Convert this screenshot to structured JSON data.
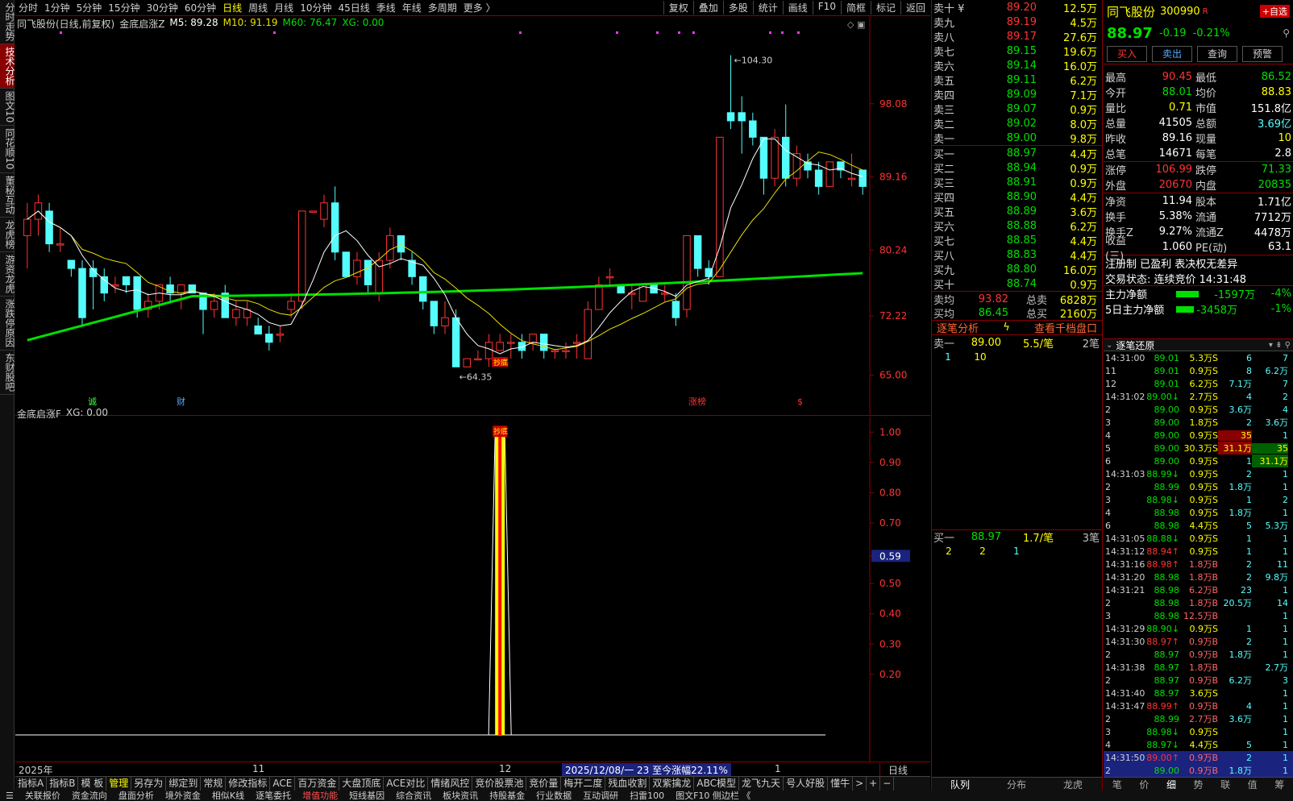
{
  "left_tabs": [
    "分时走势",
    "技术分析",
    "图文10",
    "同花顺10",
    "董秘互动",
    "龙虎榜",
    "游资龙虎",
    "涨跌停原因",
    "东财股吧"
  ],
  "toolbar": {
    "items": [
      "分时",
      "1分钟",
      "5分钟",
      "15分钟",
      "30分钟",
      "60分钟",
      "日线",
      "周线",
      "月线",
      "10分钟",
      "45日线",
      "季线",
      "年线",
      "多周期",
      "更多 〉"
    ],
    "active": "日线",
    "right": [
      "复权",
      "叠加",
      "多股",
      "统计",
      "画线",
      "F10",
      "简框",
      "标记",
      "返回"
    ]
  },
  "chart": {
    "legend_name": "同飞股份(日线,前复权)",
    "ind_name": "金底启涨Z",
    "ma5": "M5: 89.28",
    "ma10": "M10: 91.19",
    "ma60": "M60: 76.47",
    "xg": "XG: 0.00",
    "y_labels": [
      "98.08",
      "89.16",
      "80.24",
      "72.22",
      "65.00"
    ],
    "high_label": "104.30",
    "low_label": "64.35",
    "markers": [
      "诚",
      "财",
      "涨榜",
      "$"
    ],
    "buy_tag": "抄底"
  },
  "chart_data": {
    "type": "candlestick",
    "ylim": [
      62,
      107
    ],
    "candles": [
      [
        82,
        86,
        78,
        84
      ],
      [
        84,
        87,
        82,
        86
      ],
      [
        85,
        86,
        80,
        81
      ],
      [
        81,
        83,
        80,
        81
      ],
      [
        79,
        79,
        77,
        78
      ],
      [
        78,
        79,
        71,
        72
      ],
      [
        78,
        79,
        73,
        77
      ],
      [
        77,
        78,
        74,
        75
      ],
      [
        76,
        77,
        75,
        76
      ],
      [
        77,
        77,
        75,
        76
      ],
      [
        77,
        77,
        72,
        73
      ],
      [
        73,
        75,
        72,
        74
      ],
      [
        74,
        76,
        73,
        76
      ],
      [
        76,
        77,
        74,
        75
      ],
      [
        75,
        76,
        73,
        76
      ],
      [
        76,
        76,
        75,
        75
      ],
      [
        75,
        75,
        70,
        73
      ],
      [
        73,
        75,
        72,
        74
      ],
      [
        75,
        76,
        72,
        72
      ],
      [
        72,
        74,
        71,
        73
      ],
      [
        72,
        74,
        71,
        73
      ],
      [
        71,
        72,
        70,
        70
      ],
      [
        70,
        71,
        68,
        69
      ],
      [
        70,
        71,
        69,
        70
      ],
      [
        73,
        75,
        72,
        74
      ],
      [
        74,
        85,
        73,
        85
      ],
      [
        85,
        85,
        85,
        85
      ],
      [
        84,
        87,
        83,
        86
      ],
      [
        86,
        88,
        79,
        80
      ],
      [
        80,
        80,
        77,
        77
      ],
      [
        77,
        80,
        76,
        79
      ],
      [
        79,
        79,
        75,
        76
      ],
      [
        75,
        80,
        74,
        79
      ],
      [
        79,
        83,
        78,
        82
      ],
      [
        82,
        82,
        79,
        80
      ],
      [
        79,
        80,
        76,
        77
      ],
      [
        77,
        77,
        73,
        74
      ],
      [
        74,
        74,
        70,
        71
      ],
      [
        71,
        74,
        70,
        72
      ],
      [
        72,
        73,
        66,
        66
      ],
      [
        66,
        67,
        66,
        67
      ],
      [
        67,
        68,
        67,
        67
      ],
      [
        67,
        70,
        66,
        69
      ],
      [
        68,
        70,
        68,
        69
      ],
      [
        69,
        70,
        67,
        69
      ],
      [
        69,
        70,
        67,
        68
      ],
      [
        69,
        70,
        68,
        70
      ],
      [
        70,
        70,
        67,
        68
      ],
      [
        68,
        68,
        67,
        68
      ],
      [
        68,
        69,
        67,
        68
      ],
      [
        69,
        70,
        67,
        69
      ],
      [
        67,
        74,
        67,
        73
      ],
      [
        73,
        77,
        73,
        76
      ],
      [
        77,
        78,
        76,
        77
      ],
      [
        76,
        76,
        75,
        75
      ],
      [
        75,
        76,
        73,
        75
      ],
      [
        74,
        76,
        74,
        76
      ],
      [
        76,
        76,
        75,
        75
      ],
      [
        75,
        76,
        74,
        75
      ],
      [
        74,
        75,
        71,
        72
      ],
      [
        73,
        82,
        72,
        82
      ],
      [
        82,
        82,
        77,
        78
      ],
      [
        78,
        79,
        76,
        77
      ],
      [
        77,
        94,
        77,
        94
      ],
      [
        97,
        104,
        95,
        96
      ],
      [
        97,
        99,
        92,
        96
      ],
      [
        96,
        97,
        93,
        94
      ],
      [
        94,
        94,
        87,
        89
      ],
      [
        89,
        95,
        88,
        94
      ],
      [
        94,
        98,
        88,
        89
      ],
      [
        89,
        93,
        88,
        92
      ],
      [
        91,
        92,
        89,
        90
      ],
      [
        90,
        91,
        87,
        88
      ],
      [
        88,
        91,
        88,
        91
      ],
      [
        91,
        91,
        89,
        90
      ],
      [
        89,
        92,
        88,
        89
      ],
      [
        90,
        90,
        87,
        88
      ]
    ],
    "dates_x_labels": [
      "2025年",
      "11",
      "12",
      "1"
    ],
    "sub": {
      "name": "金底启涨F",
      "xg": "XG: 0.00",
      "y_labels": [
        "1.00",
        "0.90",
        "0.80",
        "0.70",
        "0.59",
        "0.50",
        "0.40",
        "0.30",
        "0.20"
      ],
      "signal_index": 43
    }
  },
  "axis": {
    "info": "2025/12/08/一 23 至今涨幅22.11%",
    "period": "日线"
  },
  "ind_tabs": [
    "指标A",
    "指标B",
    "模 板",
    "管理",
    "另存为",
    "绑定到",
    "常规",
    "修改指标",
    "ACE",
    "百万资金",
    "大盘顶底",
    "ACE对比",
    "情绪风控",
    "竞价股票池",
    "竞价量",
    "梅开二度",
    "残血收割",
    "双紫擒龙",
    "ABC模型",
    "龙飞九天",
    "号人好股",
    "懂牛"
  ],
  "ind_active": "管理",
  "statusbar": [
    "关联报价",
    "资金流向",
    "盘面分析",
    "境外资金",
    "相似K线",
    "逐笔委托",
    "增值功能",
    "短线基因",
    "综合资讯",
    "板块资讯",
    "持股基金",
    "行业数据",
    "互动调研",
    "扫雷100",
    "图文F10 侧边栏 《"
  ],
  "statusbar_hot": "增值功能",
  "orderbook": {
    "sell": [
      [
        "卖十 ¥",
        "89.20",
        "12.5万"
      ],
      [
        "卖九",
        "89.19",
        "4.5万"
      ],
      [
        "卖八",
        "89.17",
        "27.6万"
      ],
      [
        "卖七",
        "89.15",
        "19.6万"
      ],
      [
        "卖六",
        "89.14",
        "16.0万"
      ],
      [
        "卖五",
        "89.11",
        "6.2万"
      ],
      [
        "卖四",
        "89.09",
        "7.1万"
      ],
      [
        "卖三",
        "89.07",
        "0.9万"
      ],
      [
        "卖二",
        "89.02",
        "8.0万"
      ],
      [
        "卖一",
        "89.00",
        "9.8万"
      ]
    ],
    "buy": [
      [
        "买一",
        "88.97",
        "4.4万"
      ],
      [
        "买二",
        "88.94",
        "0.9万"
      ],
      [
        "买三",
        "88.91",
        "0.9万"
      ],
      [
        "买四",
        "88.90",
        "4.4万"
      ],
      [
        "买五",
        "88.89",
        "3.6万"
      ],
      [
        "买六",
        "88.88",
        "6.2万"
      ],
      [
        "买七",
        "88.85",
        "4.4万"
      ],
      [
        "买八",
        "88.83",
        "4.4万"
      ],
      [
        "买九",
        "88.80",
        "16.0万"
      ],
      [
        "买十",
        "88.74",
        "0.9万"
      ]
    ],
    "sell_avg": [
      "卖均",
      "93.82",
      "总卖",
      "6828万"
    ],
    "buy_avg": [
      "买均",
      "86.45",
      "总买",
      "2160万"
    ],
    "analysis": "逐笔分析",
    "thousand": "查看千档盘口",
    "sell1": {
      "label": "卖一",
      "price": "89.00",
      "per": "5.5/笔",
      "count": "2笔",
      "items": [
        "1",
        "10"
      ]
    },
    "buy1": {
      "label": "买一",
      "price": "88.97",
      "per": "1.7/笔",
      "count": "3笔",
      "items": [
        "2",
        "2",
        "1"
      ]
    },
    "bottom_tab": "队列"
  },
  "quote": {
    "name": "同飞股份",
    "code": "300990",
    "tag": "R",
    "add": "+自选",
    "price": "88.97",
    "change": "-0.19",
    "pct": "-0.21%",
    "buttons": [
      "买入",
      "卖出",
      "查询",
      "预警"
    ],
    "rows": [
      [
        "最高",
        "90.45",
        "最低",
        "86.52",
        "red",
        "green"
      ],
      [
        "今开",
        "88.01",
        "均价",
        "88.83",
        "green",
        "yellow"
      ],
      [
        "量比",
        "0.71",
        "市值",
        "151.8亿",
        "yellow",
        "white"
      ],
      [
        "总量",
        "41505",
        "总额",
        "3.69亿",
        "white",
        "cyan"
      ],
      [
        "昨收",
        "89.16",
        "现量",
        "10",
        "white",
        "yellow"
      ],
      [
        "总笔",
        "14671",
        "每笔",
        "2.8",
        "white",
        "white"
      ]
    ],
    "rows2": [
      [
        "涨停",
        "106.99",
        "跌停",
        "71.33",
        "red",
        "green"
      ],
      [
        "外盘",
        "20670",
        "内盘",
        "20835",
        "red",
        "green"
      ]
    ],
    "rows3": [
      [
        "净资",
        "11.94",
        "股本",
        "1.71亿"
      ],
      [
        "换手",
        "5.38%",
        "流通",
        "7712万"
      ],
      [
        "换手Z",
        "9.27%",
        "流通Z",
        "4478万"
      ],
      [
        "收益(三)",
        "1.060",
        "PE(动)",
        "63.1"
      ]
    ],
    "reg": "注册制 已盈利 表决权无差异",
    "trade_state": "交易状态: 连续竞价  14:31:48",
    "main_net": [
      "主力净额",
      "-1597万",
      "-4%"
    ],
    "main_net5": [
      "5日主力净额",
      "-3458万",
      "-1%"
    ]
  },
  "tick": {
    "title": "逐笔还原",
    "rows": [
      [
        "14:31:00",
        "89.01",
        "5.3万S",
        "6",
        "7"
      ],
      [
        "11",
        "89.01",
        "0.9万S",
        "8",
        "6.2万"
      ],
      [
        "12",
        "89.01",
        "6.2万S",
        "7.1万",
        "7"
      ],
      [
        "14:31:02",
        "89.00↓",
        "2.7万S",
        "4",
        "2"
      ],
      [
        "2",
        "89.00",
        "0.9万S",
        "3.6万",
        "4"
      ],
      [
        "3",
        "89.00",
        "1.8万S",
        "2",
        "3.6万"
      ],
      [
        "4",
        "89.00",
        "0.9万S",
        "35",
        "1"
      ],
      [
        "5",
        "89.00",
        "30.3万S",
        "31.1万",
        "35"
      ],
      [
        "6",
        "89.00",
        "0.9万S",
        "1",
        "31.1万"
      ],
      [
        "14:31:03",
        "88.99↓",
        "0.9万S",
        "2",
        "1"
      ],
      [
        "2",
        "88.99",
        "0.9万S",
        "1.8万",
        "1"
      ],
      [
        "3",
        "88.98↓",
        "0.9万S",
        "1",
        "2"
      ],
      [
        "4",
        "88.98",
        "0.9万S",
        "1.8万",
        "1"
      ],
      [
        "6",
        "88.98",
        "4.4万S",
        "5",
        "5.3万"
      ],
      [
        "14:31:05",
        "88.88↓",
        "0.9万S",
        "1",
        "1"
      ],
      [
        "14:31:12",
        "88.94↑",
        "0.9万S",
        "1",
        "1"
      ],
      [
        "14:31:16",
        "88.98↑",
        "1.8万B",
        "2",
        "11"
      ],
      [
        "14:31:20",
        "88.98",
        "1.8万B",
        "2",
        "9.8万"
      ],
      [
        "14:31:21",
        "88.98",
        "6.2万B",
        "23",
        "1"
      ],
      [
        "2",
        "88.98",
        "1.8万B",
        "20.5万",
        "14"
      ],
      [
        "3",
        "88.98",
        "12.5万B",
        "",
        "1"
      ],
      [
        "14:31:29",
        "88.90↓",
        "0.9万S",
        "1",
        "1"
      ],
      [
        "14:31:30",
        "88.97↑",
        "0.9万B",
        "2",
        "1"
      ],
      [
        "2",
        "88.97",
        "0.9万B",
        "1.8万",
        "1"
      ],
      [
        "14:31:38",
        "88.97",
        "1.8万B",
        "",
        "2.7万"
      ],
      [
        "2",
        "88.97",
        "0.9万B",
        "6.2万",
        "3"
      ],
      [
        "14:31:40",
        "88.97",
        "3.6万S",
        "",
        "1"
      ],
      [
        "14:31:47",
        "88.99↑",
        "0.9万B",
        "4",
        "1"
      ],
      [
        "2",
        "88.99",
        "2.7万B",
        "3.6万",
        "1"
      ],
      [
        "3",
        "88.98↓",
        "0.9万S",
        "",
        "1"
      ],
      [
        "4",
        "88.97↓",
        "4.4万S",
        "5",
        "1"
      ],
      [
        "14:31:50",
        "89.00↑",
        "0.9万B",
        "2",
        "1"
      ],
      [
        "2",
        "89.00",
        "0.9万B",
        "1.8万",
        "1"
      ]
    ],
    "tabs": [
      "笔",
      "价",
      "细",
      "势",
      "联",
      "值",
      "筹"
    ]
  },
  "colors": {
    "up": "#ff3333",
    "down": "#54fcfc",
    "ma5": "#ffffff",
    "ma10": "#e8e000",
    "ma60": "#00e000",
    "border": "#8b0000"
  }
}
